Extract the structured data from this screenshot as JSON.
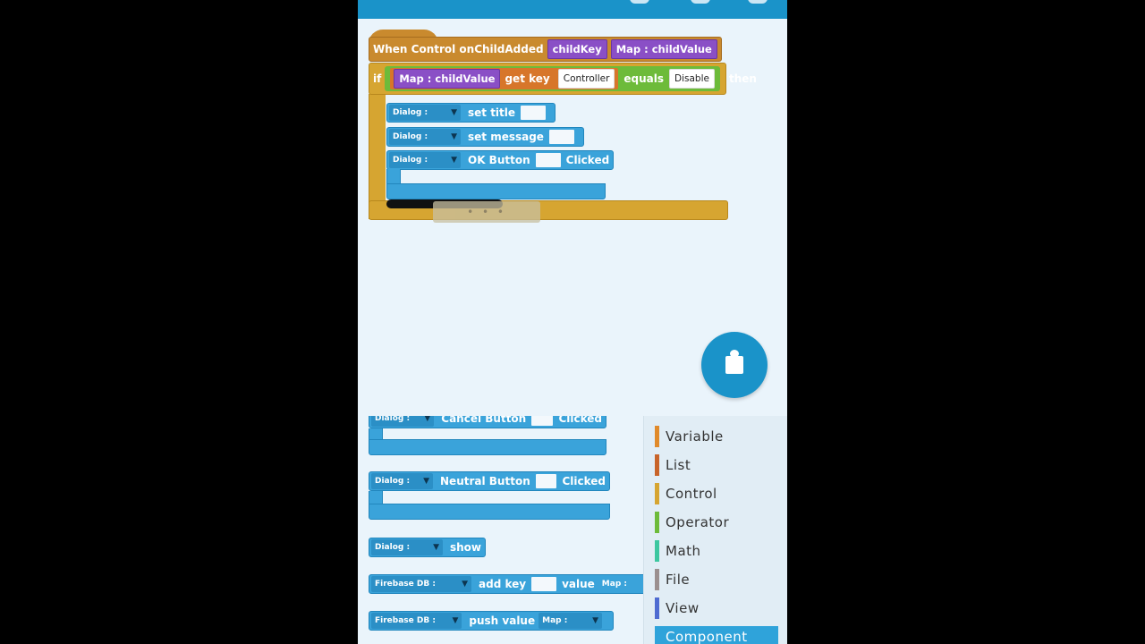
{
  "event": {
    "label": "When Control onChildAdded",
    "params": [
      "childKey",
      "Map : childValue"
    ]
  },
  "if_block": {
    "if_label": "if",
    "map_chip": "Map : childValue",
    "get_key": "get key",
    "key_value": "Controller",
    "equals": "equals",
    "equals_value": "Disable",
    "then": "then"
  },
  "inner_blocks": [
    {
      "component": "Dialog :",
      "action": "set title"
    },
    {
      "component": "Dialog :",
      "action": "set message"
    },
    {
      "component": "Dialog :",
      "action": "OK Button",
      "suffix": "Clicked"
    }
  ],
  "drag_ghost": "• • •",
  "palette": [
    {
      "component": "Dialog :",
      "action": "Cancel Button",
      "suffix": "Clicked"
    },
    {
      "component": "Dialog :",
      "action": "Neutral Button",
      "suffix": "Clicked"
    },
    {
      "component": "Dialog :",
      "action": "show"
    },
    {
      "component": "Firebase DB :",
      "action": "add key",
      "middle": "value",
      "tail": "Map :"
    },
    {
      "component": "Firebase DB :",
      "action": "push value",
      "tail": "Map :"
    }
  ],
  "categories": [
    {
      "label": "Variable",
      "color": "#e08a2a"
    },
    {
      "label": "List",
      "color": "#c8642a"
    },
    {
      "label": "Control",
      "color": "#d6a531"
    },
    {
      "label": "Operator",
      "color": "#6dbb3a"
    },
    {
      "label": "Math",
      "color": "#3cc7a0"
    },
    {
      "label": "File",
      "color": "#9a8f8f"
    },
    {
      "label": "View",
      "color": "#4e6bd1"
    },
    {
      "label": "Component",
      "color": "#2fa3da"
    }
  ],
  "fab_icon": "puzzle-icon",
  "colors": {
    "accent": "#1a93c9",
    "control": "#d6a531",
    "event": "#c98a2e",
    "component": "#3aa3da"
  }
}
